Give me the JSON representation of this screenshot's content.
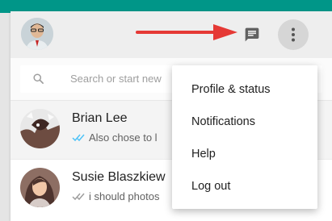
{
  "header": {
    "avatar_icon": "user-avatar",
    "new_chat_icon": "chat-icon",
    "menu_icon": "more-vertical-icon"
  },
  "search": {
    "placeholder": "Search or start new",
    "icon": "search-icon"
  },
  "chats": [
    {
      "name": "Brian Lee",
      "preview": "Also chose to l",
      "read_receipt": "double-check",
      "receipt_color": "#4fc3f7"
    },
    {
      "name": "Susie Blaszkiew",
      "preview": "i should photos",
      "read_receipt": "double-check",
      "receipt_color": "#9e9e9e"
    }
  ],
  "menu": {
    "items": [
      {
        "label": "Profile & status"
      },
      {
        "label": "Notifications"
      },
      {
        "label": "Help"
      },
      {
        "label": "Log out"
      }
    ]
  },
  "colors": {
    "brand_teal": "#009688",
    "annotation_arrow": "#e53935"
  }
}
